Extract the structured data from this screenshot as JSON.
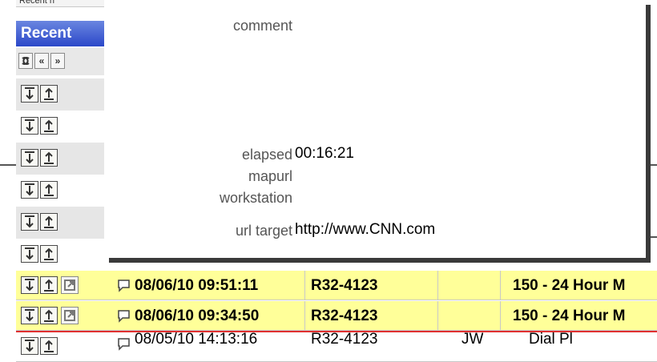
{
  "background": {
    "top_cut_label": "Recent n",
    "recent_title": "Recent",
    "nav_buttons": [
      "refresh",
      "«",
      "»"
    ],
    "rows": [
      {
        "datetime": "08/06/10 09:51:11",
        "unit": "R32-4123",
        "user": "",
        "type": "150 - 24 Hour M",
        "highlight": true
      },
      {
        "datetime": "08/06/10 09:34:50",
        "unit": "R32-4123",
        "user": "",
        "type": "150 - 24 Hour M",
        "highlight": true
      },
      {
        "datetime": "08/05/10 14:13:16",
        "unit": "R32-4123",
        "user": "JW",
        "type": "Dial Pl",
        "highlight": false
      }
    ]
  },
  "popup": {
    "fields": [
      {
        "label": "comment",
        "value": ""
      },
      {
        "label": "elapsed",
        "value": "00:16:21"
      },
      {
        "label": "mapurl",
        "value": ""
      },
      {
        "label": "workstation",
        "value": ""
      },
      {
        "label": "url target",
        "value": "http://www.CNN.com"
      }
    ]
  }
}
